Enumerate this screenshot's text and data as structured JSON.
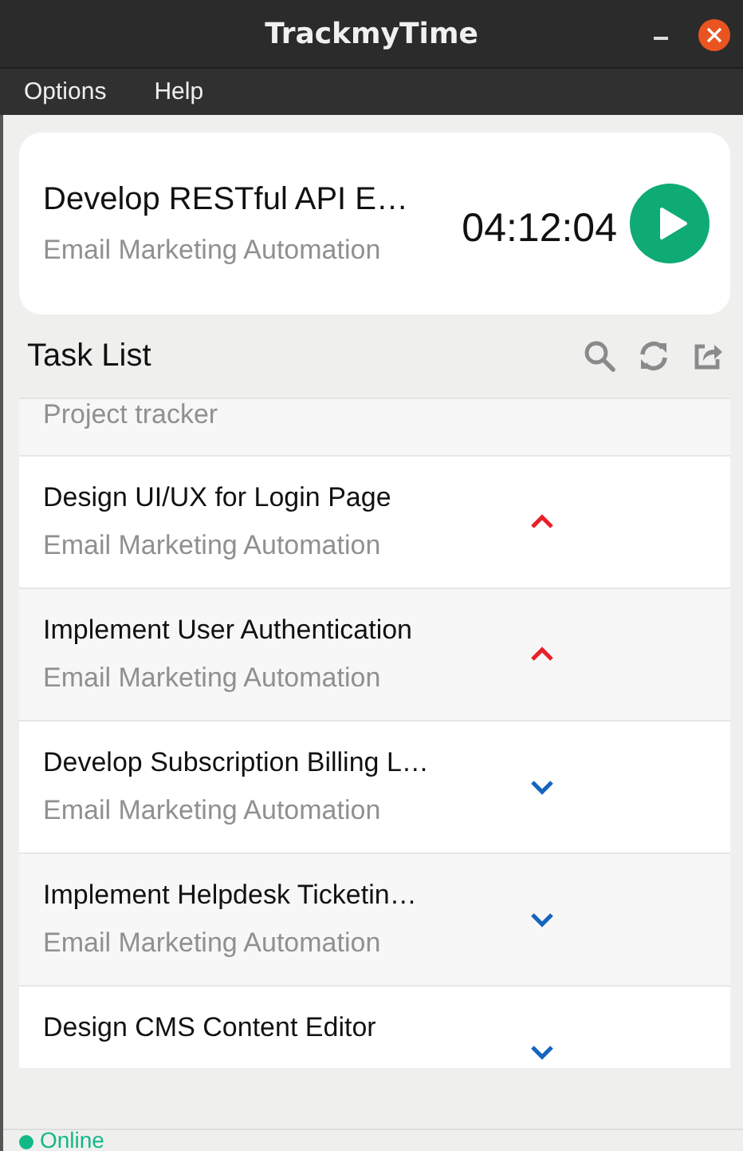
{
  "window": {
    "title": "TrackmyTime"
  },
  "menu": [
    "Options",
    "Help"
  ],
  "current_task": {
    "title": "Develop RESTful API E…",
    "project": "Email Marketing Automation",
    "timer": "04:12:04"
  },
  "task_list": {
    "title": "Task List",
    "rows": [
      {
        "project": "Project tracker"
      },
      {
        "title": "Design UI/UX for Login Page",
        "project": "Email Marketing Automation",
        "kind": "high"
      },
      {
        "title": "Implement User Authentication",
        "project": "Email Marketing Automation",
        "kind": "high"
      },
      {
        "title": "Develop Subscription Billing L…",
        "project": "Email Marketing Automation",
        "kind": "low"
      },
      {
        "title": "Implement Helpdesk Ticketin…",
        "project": "Email Marketing Automation",
        "kind": "low"
      },
      {
        "title": "Design CMS Content Editor",
        "kind": "low"
      }
    ]
  },
  "status": {
    "text": "Online",
    "color": "#12b886"
  }
}
